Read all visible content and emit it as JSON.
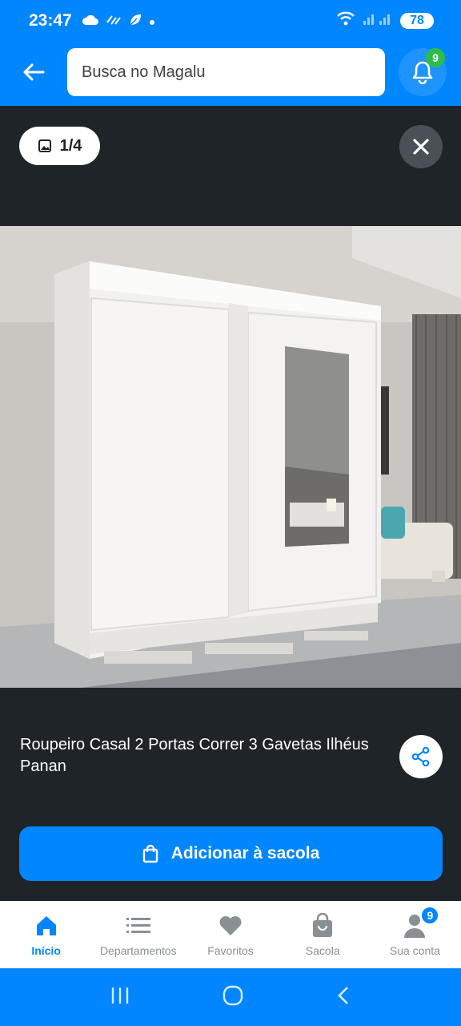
{
  "status_bar": {
    "time": "23:47",
    "battery": "78"
  },
  "header": {
    "search_placeholder": "Busca no Magalu",
    "notification_count": "9"
  },
  "gallery": {
    "counter": "1/4"
  },
  "product": {
    "title": "Roupeiro Casal 2 Portas Correr 3 Gavetas Ilhéus Panan",
    "add_to_bag_label": "Adicionar à sacola"
  },
  "bottom_nav": {
    "items": [
      {
        "label": "Início",
        "icon": "home-icon",
        "active": true
      },
      {
        "label": "Departamentos",
        "icon": "list-icon",
        "active": false
      },
      {
        "label": "Favoritos",
        "icon": "heart-icon",
        "active": false
      },
      {
        "label": "Sacola",
        "icon": "bag-icon",
        "active": false
      },
      {
        "label": "Sua conta",
        "icon": "user-icon",
        "active": false
      }
    ],
    "account_badge": "9"
  },
  "colors": {
    "brand_blue": "#0086ff",
    "dark_bg": "#1f2428",
    "badge_green": "#2fbd4a"
  }
}
